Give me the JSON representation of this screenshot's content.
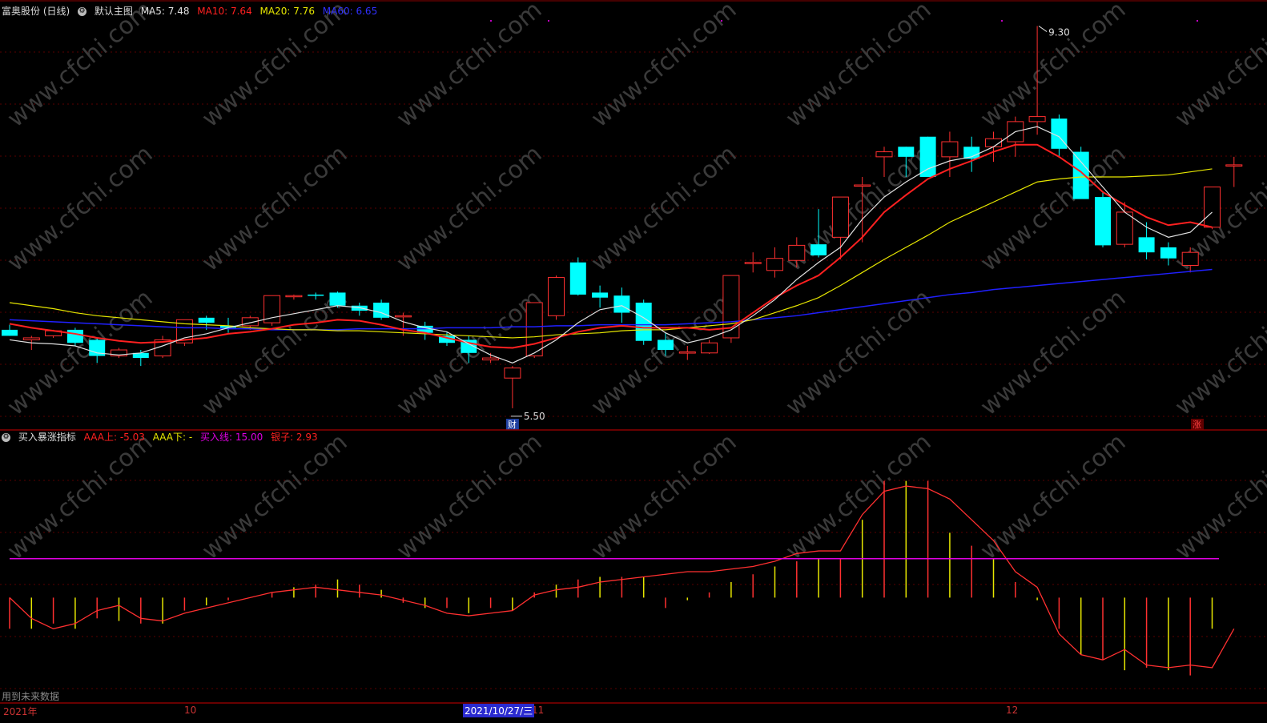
{
  "header": {
    "stock_name": "富奥股份 (日线)",
    "template_name": "默认主图",
    "ma5": "MA5: 7.48",
    "ma10": "MA10: 7.64",
    "ma20": "MA20: 7.76",
    "ma60": "MA60: 6.65"
  },
  "indicator_header": {
    "name": "买入暴涨指标",
    "aaa_up": "AAA上: -5.03",
    "aaa_down": "AAA下: -",
    "buy_line": "买入线: 15.00",
    "banker": "银子: 2.93"
  },
  "annotations": {
    "high_label": "9.30",
    "low_label": "5.50",
    "finance_badge": "财",
    "limit_up_badge": "涨",
    "future_data_note": "用到未来数据"
  },
  "time_axis": {
    "labels": [
      "2021年",
      "10",
      "11",
      "12"
    ],
    "cursor_date": "2021/10/27/三"
  },
  "colors": {
    "up": "#ff3030",
    "down": "#00ffff",
    "ma5": "#e0e0e0",
    "ma10": "#ff2020",
    "ma20": "#e6e600",
    "ma60": "#2020ff",
    "buy_line": "#e000e0",
    "grid": "#5a0000"
  },
  "chart_data": [
    {
      "type": "candlestick",
      "title": "富奥股份 (日线)",
      "ylim": [
        5.3,
        9.4
      ],
      "candles": [
        {
          "o": 6.28,
          "h": 6.33,
          "l": 6.22,
          "c": 6.22
        },
        {
          "o": 6.18,
          "h": 6.22,
          "l": 6.08,
          "c": 6.2
        },
        {
          "o": 6.22,
          "h": 6.28,
          "l": 6.2,
          "c": 6.27
        },
        {
          "o": 6.28,
          "h": 6.3,
          "l": 6.12,
          "c": 6.15
        },
        {
          "o": 6.18,
          "h": 6.2,
          "l": 5.95,
          "c": 6.02
        },
        {
          "o": 6.02,
          "h": 6.1,
          "l": 6.0,
          "c": 6.08
        },
        {
          "o": 6.05,
          "h": 6.08,
          "l": 5.92,
          "c": 6.0
        },
        {
          "o": 6.02,
          "h": 6.22,
          "l": 6.0,
          "c": 6.18
        },
        {
          "o": 6.15,
          "h": 6.38,
          "l": 6.12,
          "c": 6.38
        },
        {
          "o": 6.4,
          "h": 6.42,
          "l": 6.28,
          "c": 6.35
        },
        {
          "o": 6.32,
          "h": 6.4,
          "l": 6.25,
          "c": 6.3
        },
        {
          "o": 6.32,
          "h": 6.42,
          "l": 6.28,
          "c": 6.4
        },
        {
          "o": 6.35,
          "h": 6.62,
          "l": 6.32,
          "c": 6.62
        },
        {
          "o": 6.61,
          "h": 6.63,
          "l": 6.58,
          "c": 6.62
        },
        {
          "o": 6.63,
          "h": 6.65,
          "l": 6.58,
          "c": 6.62
        },
        {
          "o": 6.65,
          "h": 6.66,
          "l": 6.5,
          "c": 6.52
        },
        {
          "o": 6.52,
          "h": 6.55,
          "l": 6.42,
          "c": 6.47
        },
        {
          "o": 6.55,
          "h": 6.58,
          "l": 6.38,
          "c": 6.4
        },
        {
          "o": 6.42,
          "h": 6.45,
          "l": 6.22,
          "c": 6.42
        },
        {
          "o": 6.32,
          "h": 6.36,
          "l": 6.18,
          "c": 6.25
        },
        {
          "o": 6.22,
          "h": 6.26,
          "l": 6.12,
          "c": 6.15
        },
        {
          "o": 6.18,
          "h": 6.22,
          "l": 5.95,
          "c": 6.05
        },
        {
          "o": 5.98,
          "h": 6.05,
          "l": 5.95,
          "c": 6.0
        },
        {
          "o": 5.8,
          "h": 5.92,
          "l": 5.5,
          "c": 5.9
        },
        {
          "o": 6.02,
          "h": 6.55,
          "l": 6.0,
          "c": 6.55
        },
        {
          "o": 6.42,
          "h": 6.82,
          "l": 6.38,
          "c": 6.8
        },
        {
          "o": 6.95,
          "h": 7.0,
          "l": 6.62,
          "c": 6.63
        },
        {
          "o": 6.65,
          "h": 6.72,
          "l": 6.5,
          "c": 6.6
        },
        {
          "o": 6.62,
          "h": 6.7,
          "l": 6.35,
          "c": 6.45
        },
        {
          "o": 6.55,
          "h": 6.58,
          "l": 6.13,
          "c": 6.17
        },
        {
          "o": 6.18,
          "h": 6.25,
          "l": 6.02,
          "c": 6.08
        },
        {
          "o": 6.06,
          "h": 6.12,
          "l": 5.98,
          "c": 6.06
        },
        {
          "o": 6.05,
          "h": 6.18,
          "l": 6.04,
          "c": 6.15
        },
        {
          "o": 6.2,
          "h": 6.82,
          "l": 6.15,
          "c": 6.82
        },
        {
          "o": 6.95,
          "h": 7.05,
          "l": 6.85,
          "c": 6.95
        },
        {
          "o": 6.87,
          "h": 7.1,
          "l": 6.8,
          "c": 6.99
        },
        {
          "o": 6.97,
          "h": 7.2,
          "l": 6.9,
          "c": 7.12
        },
        {
          "o": 7.13,
          "h": 7.48,
          "l": 7.0,
          "c": 7.02
        },
        {
          "o": 7.2,
          "h": 7.6,
          "l": 6.98,
          "c": 7.6
        },
        {
          "o": 7.72,
          "h": 7.8,
          "l": 7.15,
          "c": 7.72
        },
        {
          "o": 8.0,
          "h": 8.1,
          "l": 7.8,
          "c": 8.05
        },
        {
          "o": 8.1,
          "h": 8.1,
          "l": 7.8,
          "c": 8.0
        },
        {
          "o": 8.2,
          "h": 8.2,
          "l": 7.8,
          "c": 7.8
        },
        {
          "o": 8.0,
          "h": 8.25,
          "l": 7.8,
          "c": 8.15
        },
        {
          "o": 8.1,
          "h": 8.2,
          "l": 7.85,
          "c": 7.98
        },
        {
          "o": 8.1,
          "h": 8.25,
          "l": 7.95,
          "c": 8.18
        },
        {
          "o": 8.15,
          "h": 8.4,
          "l": 8.0,
          "c": 8.35
        },
        {
          "o": 8.35,
          "h": 9.3,
          "l": 8.22,
          "c": 8.4
        },
        {
          "o": 8.38,
          "h": 8.42,
          "l": 8.0,
          "c": 8.08
        },
        {
          "o": 8.05,
          "h": 8.1,
          "l": 7.6,
          "c": 7.58
        },
        {
          "o": 7.6,
          "h": 7.65,
          "l": 7.1,
          "c": 7.12
        },
        {
          "o": 7.13,
          "h": 7.55,
          "l": 7.1,
          "c": 7.45
        },
        {
          "o": 7.2,
          "h": 7.35,
          "l": 6.98,
          "c": 7.05
        },
        {
          "o": 7.1,
          "h": 7.15,
          "l": 6.92,
          "c": 6.99
        },
        {
          "o": 6.92,
          "h": 7.1,
          "l": 6.85,
          "c": 7.05
        },
        {
          "o": 7.3,
          "h": 7.7,
          "l": 7.28,
          "c": 7.7
        },
        {
          "o": 7.92,
          "h": 8.0,
          "l": 7.7,
          "c": 7.92
        }
      ],
      "ma5": [
        6.18,
        6.15,
        6.14,
        6.12,
        6.05,
        6.03,
        6.05,
        6.12,
        6.2,
        6.24,
        6.3,
        6.35,
        6.4,
        6.44,
        6.48,
        6.52,
        6.5,
        6.45,
        6.36,
        6.3,
        6.26,
        6.14,
        6.03,
        5.95,
        6.05,
        6.18,
        6.35,
        6.48,
        6.52,
        6.4,
        6.25,
        6.15,
        6.2,
        6.28,
        6.42,
        6.58,
        6.78,
        6.95,
        7.1,
        7.38,
        7.6,
        7.75,
        7.88,
        7.96,
        8.0,
        8.1,
        8.25,
        8.3,
        8.2,
        7.95,
        7.7,
        7.45,
        7.3,
        7.2,
        7.25,
        7.45
      ],
      "ma10": [
        6.34,
        6.3,
        6.27,
        6.24,
        6.2,
        6.17,
        6.15,
        6.16,
        6.18,
        6.2,
        6.24,
        6.26,
        6.29,
        6.33,
        6.35,
        6.38,
        6.37,
        6.33,
        6.28,
        6.25,
        6.2,
        6.15,
        6.11,
        6.1,
        6.14,
        6.2,
        6.26,
        6.3,
        6.32,
        6.3,
        6.3,
        6.3,
        6.28,
        6.3,
        6.45,
        6.6,
        6.72,
        6.82,
        7.0,
        7.2,
        7.45,
        7.62,
        7.78,
        7.88,
        7.96,
        8.05,
        8.12,
        8.12,
        8.0,
        7.85,
        7.65,
        7.52,
        7.4,
        7.32,
        7.35,
        7.3
      ],
      "ma20": [
        6.55,
        6.52,
        6.49,
        6.45,
        6.42,
        6.4,
        6.38,
        6.36,
        6.34,
        6.33,
        6.32,
        6.3,
        6.29,
        6.28,
        6.28,
        6.27,
        6.27,
        6.26,
        6.25,
        6.24,
        6.23,
        6.22,
        6.21,
        6.2,
        6.21,
        6.23,
        6.24,
        6.25,
        6.27,
        6.28,
        6.28,
        6.3,
        6.32,
        6.34,
        6.38,
        6.45,
        6.52,
        6.6,
        6.72,
        6.85,
        6.98,
        7.1,
        7.22,
        7.35,
        7.45,
        7.55,
        7.65,
        7.75,
        7.78,
        7.8,
        7.8,
        7.8,
        7.81,
        7.82,
        7.85,
        7.88
      ],
      "ma60": [
        6.38,
        6.37,
        6.36,
        6.35,
        6.34,
        6.33,
        6.32,
        6.31,
        6.3,
        6.3,
        6.29,
        6.29,
        6.28,
        6.28,
        6.28,
        6.28,
        6.29,
        6.29,
        6.29,
        6.29,
        6.3,
        6.3,
        6.3,
        6.31,
        6.31,
        6.32,
        6.32,
        6.33,
        6.33,
        6.33,
        6.33,
        6.34,
        6.35,
        6.36,
        6.38,
        6.4,
        6.42,
        6.45,
        6.48,
        6.51,
        6.54,
        6.57,
        6.6,
        6.63,
        6.65,
        6.68,
        6.7,
        6.72,
        6.74,
        6.76,
        6.78,
        6.8,
        6.82,
        6.84,
        6.86,
        6.88
      ],
      "high_marker": {
        "index": 47,
        "value": 9.3
      },
      "low_marker": {
        "index": 23,
        "value": 5.5
      }
    },
    {
      "type": "bar",
      "title": "买入暴涨指标",
      "ylim": [
        -40,
        60
      ],
      "buy_line": 15.0,
      "aaa_values": [
        0,
        -8,
        -12,
        -10,
        -5,
        -3,
        -8,
        -9,
        -6,
        -4,
        -2,
        0,
        2,
        3,
        4,
        3,
        2,
        1,
        -1,
        -3,
        -6,
        -7,
        -6,
        -5,
        1,
        3,
        4,
        6,
        7,
        8,
        9,
        10,
        10,
        11,
        12,
        14,
        17,
        18,
        18,
        32,
        41,
        43,
        42,
        38,
        30,
        22,
        10,
        4,
        -14,
        -22,
        -24,
        -20,
        -26,
        -27,
        -26,
        -27,
        -12
      ],
      "hist_values": [
        -12,
        -12,
        -10,
        -12,
        -8,
        -9,
        -10,
        -10,
        -5,
        -3,
        -1,
        0,
        2,
        4,
        5,
        7,
        5,
        3,
        -2,
        -4,
        -4,
        -6,
        -4,
        -5,
        2,
        5,
        7,
        8,
        8,
        8,
        -4,
        -1,
        2,
        6,
        9,
        12,
        14,
        15,
        15,
        30,
        45,
        45,
        45,
        25,
        20,
        15,
        6,
        -1,
        -12,
        -22,
        -24,
        -28,
        -27,
        -28,
        -30,
        -12
      ],
      "series": [
        {
          "name": "AAA上",
          "color": "#ff2020"
        },
        {
          "name": "AAA下",
          "color": "#e6e600"
        },
        {
          "name": "买入线",
          "color": "#e000e0"
        }
      ]
    }
  ]
}
